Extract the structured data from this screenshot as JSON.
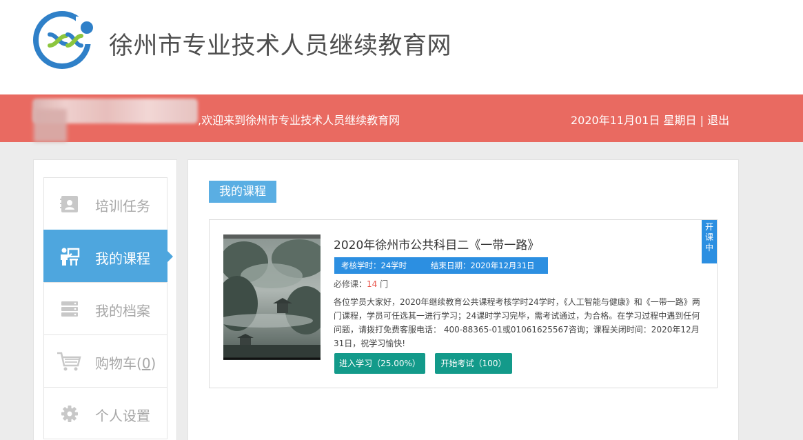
{
  "site": {
    "title": "徐州市专业技术人员继续教育网",
    "welcome": ",欢迎来到徐州市专业技术人员继续教育网",
    "date": "2020年11月01日 星期日",
    "separator": "|",
    "logout": "退出"
  },
  "sidebar": {
    "items": [
      {
        "label": "培训任务",
        "icon": "id-card-icon"
      },
      {
        "label": "我的课程",
        "icon": "classroom-icon",
        "active": true
      },
      {
        "label": "我的档案",
        "icon": "server-icon"
      },
      {
        "label": "购物车",
        "count": "0",
        "icon": "cart-icon"
      },
      {
        "label": "个人设置",
        "icon": "gear-icon"
      }
    ]
  },
  "main": {
    "section_title": "我的课程",
    "course": {
      "title": "2020年徐州市公共科目二《一带一路》",
      "hours": "考核学时：24学时",
      "end_date": "结束日期：2020年12月31日",
      "required_label": "必修课：",
      "required_count": "14",
      "required_unit": " 门",
      "description": "各位学员大家好，2020年继续教育公共课程考核学时24学时，《人工智能与健康》和《一带一路》两门课程，学员可任选其一进行学习；24课时学习完毕，需考试通过，为合格。在学习过程中遇到任何问题，请拨打免费客服电话： 400-88365-01或01061625567咨询；课程关闭时间：2020年12月31日，祝学习愉快!",
      "study_button": "进入学习（25.00%）",
      "exam_button": "开始考试（100）",
      "status": [
        "开",
        "课",
        "中"
      ],
      "progress_percent": 25
    }
  },
  "colors": {
    "red_bar": "#e96a61",
    "accent_blue": "#4ea6de",
    "button_teal": "#139a8a"
  }
}
